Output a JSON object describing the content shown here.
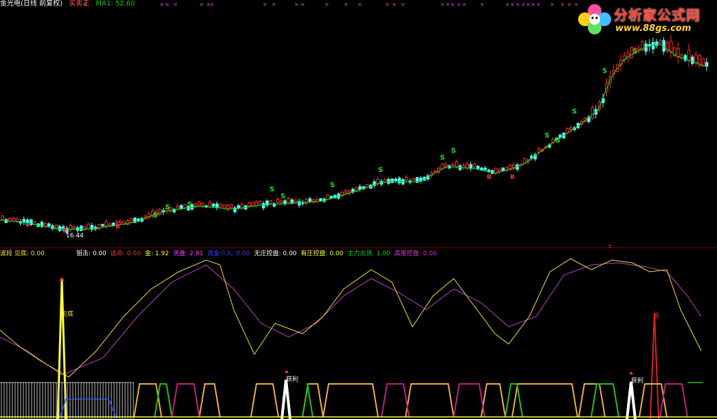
{
  "header": {
    "stock_name": "金光电(日线 前复权)",
    "indicator_name": "买卖王",
    "ma_label": "MA1: 52.60"
  },
  "logo": {
    "text": "分析家公式网",
    "url": "www.88gs.com"
  },
  "colors": {
    "up_candle": "#ff2a2a",
    "down_candle": "#54ffff",
    "ma_line": "#10d010",
    "signal_yellow": "#f0e040",
    "signal_magenta": "#c040c0",
    "divider": "#7a0000"
  },
  "main_chart": {
    "low_price_label": "16.44",
    "markers": [
      "S",
      "B"
    ]
  },
  "legend": {
    "items": [
      {
        "label": "波段 见底: ",
        "value": "0.00",
        "color": "#f0e040"
      },
      {
        "label": "狙击: ",
        "value": "0.00",
        "color": "#ffffff"
      },
      {
        "label": "逃命: ",
        "value": "0.00",
        "color": "#ff3030"
      },
      {
        "label": "金: ",
        "value": "1.92",
        "color": "#ffff40"
      },
      {
        "label": "洗盘: ",
        "value": "2.91",
        "color": "#ff40ff"
      },
      {
        "label": "资金介入: ",
        "value": "0.00",
        "color": "#4040ff"
      },
      {
        "label": "无庄控盘: ",
        "value": "0.00",
        "color": "#ffffff"
      },
      {
        "label": "有庄控盘: ",
        "value": "0.00",
        "color": "#ffff40"
      },
      {
        "label": "主力出货: ",
        "value": "1.00",
        "color": "#20d020"
      },
      {
        "label": "高度控盘: ",
        "value": "0.00",
        "color": "#d040d0"
      }
    ]
  },
  "sub_chart": {
    "bottom_label": "见底",
    "profit_label_1": "获利",
    "profit_label_2": "获利",
    "escape_label": "逃"
  }
}
